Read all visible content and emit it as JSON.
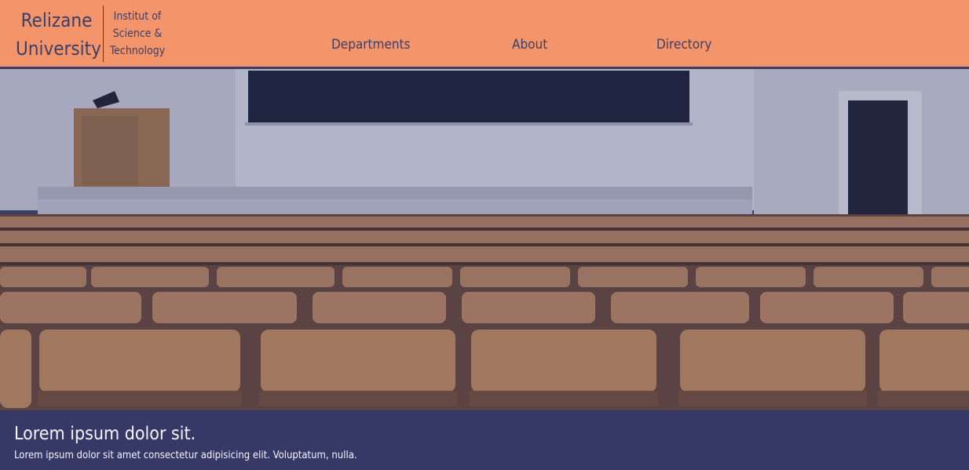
{
  "header": {
    "logo_line1": "Relizane",
    "logo_line2": "University",
    "subtitle_line1": "Institut of",
    "subtitle_line2": "Science &",
    "subtitle_line3": "Technology",
    "nav": [
      {
        "label": "Departments"
      },
      {
        "label": "About"
      },
      {
        "label": "Directory"
      }
    ]
  },
  "hero": {
    "image": "lecture-hall-photo",
    "title": "Lorem ipsum dolor sit.",
    "text": "Lorem ipsum dolor sit amet consectetur adipisicing elit. Voluptatum, nulla."
  },
  "colors": {
    "header_bg": "#f4946a",
    "accent": "#3b3f67",
    "caption_bg": "#2e366e"
  }
}
